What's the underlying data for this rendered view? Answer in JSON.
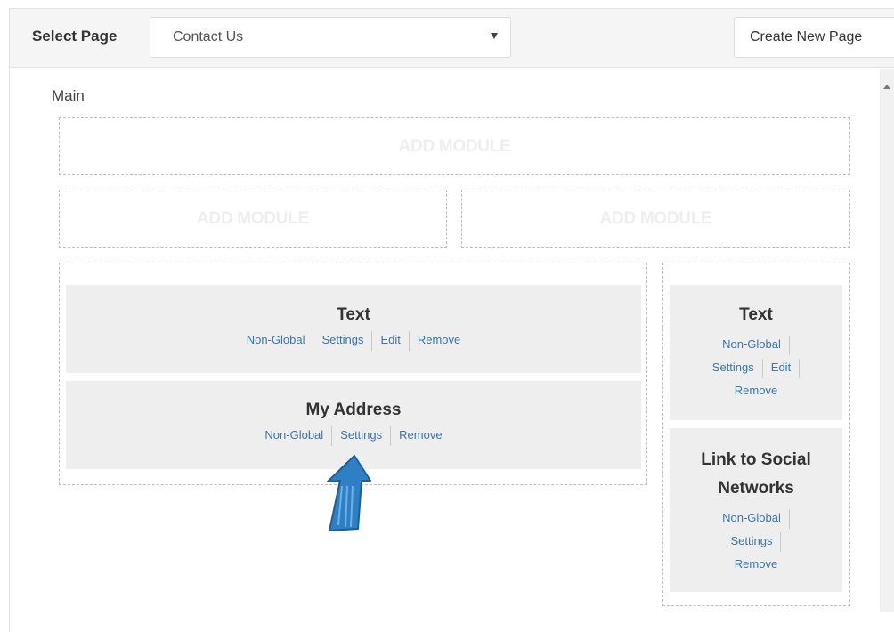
{
  "topbar": {
    "select_label": "Select Page",
    "selected_page": "Contact Us",
    "create_button": "Create New Page"
  },
  "main": {
    "label": "Main",
    "add_module_label": "ADD MODULE",
    "left_modules": [
      {
        "title": "Text",
        "links": [
          "Non-Global",
          "Settings",
          "Edit",
          "Remove"
        ]
      },
      {
        "title": "My Address",
        "links": [
          "Non-Global",
          "Settings",
          "Remove"
        ]
      }
    ],
    "right_modules": [
      {
        "title": "Text",
        "links": [
          "Non-Global",
          "Settings",
          "Edit",
          "Remove"
        ]
      },
      {
        "title_lines": [
          "Link to Social",
          "Networks"
        ],
        "links": [
          "Non-Global",
          "Settings",
          "Remove"
        ]
      }
    ]
  },
  "colors": {
    "link": "#3a75ad",
    "module_bg": "#eeeeee",
    "annotation_arrow": "#2f7fc4"
  }
}
